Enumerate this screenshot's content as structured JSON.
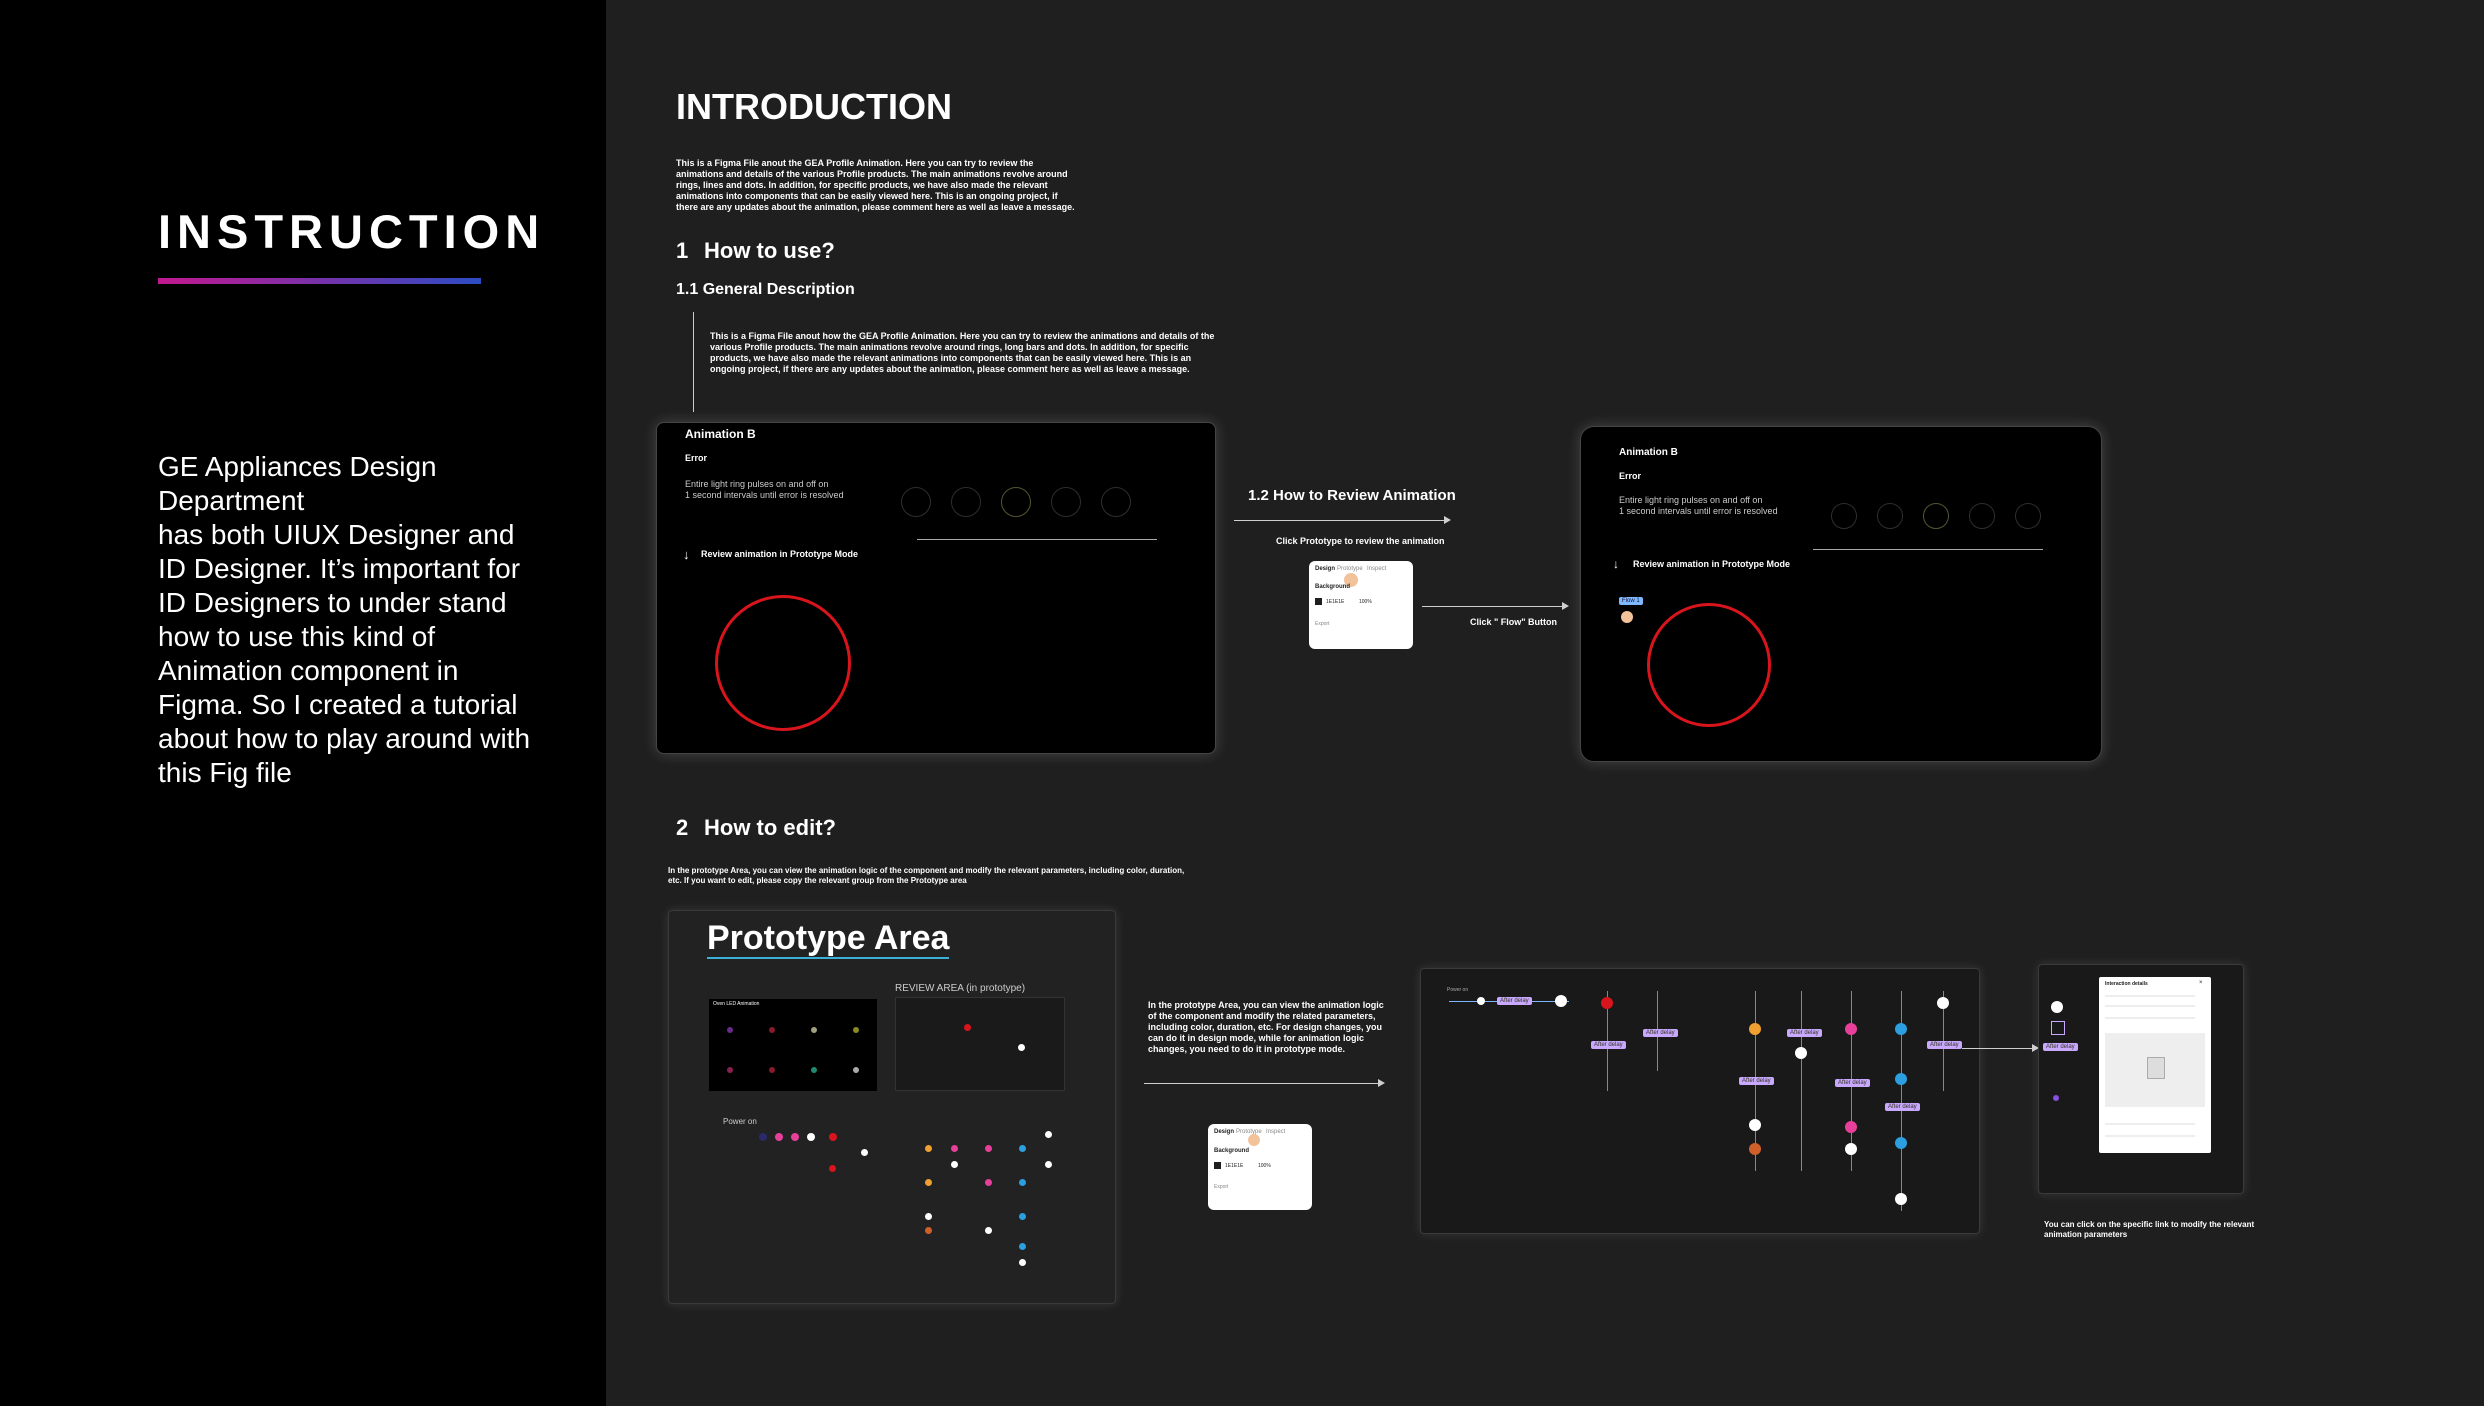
{
  "sidebar": {
    "title": "INSTRUCTION",
    "description": "GE Appliances Design Department\nhas both UIUX Designer and ID Designer. It’s important for ID Designers to under stand how to use this kind of Animation component in Figma. So I created a tutorial about how to play around with this Fig file",
    "accent_gradient": [
      "#c2188f",
      "#2c4cc4"
    ]
  },
  "intro": {
    "title": "INTRODUCTION",
    "text": "This is a Figma File anout the GEA Profile Animation. Here you can try to review the animations and details of the various Profile products. The main animations revolve around rings, lines and dots. In addition, for specific products, we have also made the relevant animations into components that can be easily viewed here. This is an ongoing project, if there are any updates about the animation, please comment here as well as leave a message."
  },
  "section1": {
    "number": "1",
    "title": "How to use?",
    "sub_title": "1.1 General Description",
    "description": "This is a Figma File anout how the GEA Profile Animation. Here you can try to review the animations and details of the various Profile products. The main animations revolve around rings, long bars and dots. In addition, for specific products, we have also made the relevant animations into components that can be easily viewed here. This is an ongoing project, if there are any updates about the animation, please comment here as well as leave a message.",
    "panel": {
      "title": "Animation B",
      "state": "Error",
      "caption": "Entire light ring pulses on and off on\n1 second intervals until error is resolved",
      "review_label": "Review animation in Prototype Mode",
      "ring_color": "#d8141c"
    },
    "review": {
      "title": "1.2 How to Review Animation",
      "click_prototype": "Click Prototype to review the animation",
      "click_flow": "Click \" Flow\" Button",
      "card": {
        "tabs": [
          "Design",
          "Prototype",
          "Inspect"
        ],
        "background_label": "Background",
        "color_hex": "1E1E1E",
        "opacity": "100%",
        "export_label": "Export"
      },
      "flow_tag": "Flow 1"
    }
  },
  "section2": {
    "number": "2",
    "title": "How to edit?",
    "description": "In the prototype Area, you can view the animation logic of the component and modify the relevant parameters, including color, duration, etc. If you want to edit, please copy the relevant group from the Prototype area",
    "prototype_title": "Prototype Area",
    "review_area_label": "REVIEW AREA (in prototype)",
    "led_label": "Oven LED Animation",
    "power_label": "Power on",
    "explain_text": "In the prototype Area, you can view the animation logic of the component and modify the related parameters, including color, duration, etc. For design changes, you can do it in design mode, while for animation logic changes, you need to do it in prototype mode.",
    "flow_tag_label": "After delay",
    "link_note": "You can click on the specific link to modify the relevant animation parameters",
    "interaction_title": "Interaction details",
    "dot_colors": [
      "#d8141c",
      "#e8409a",
      "#2b9fe0",
      "#f0a030",
      "#ffffff"
    ]
  }
}
